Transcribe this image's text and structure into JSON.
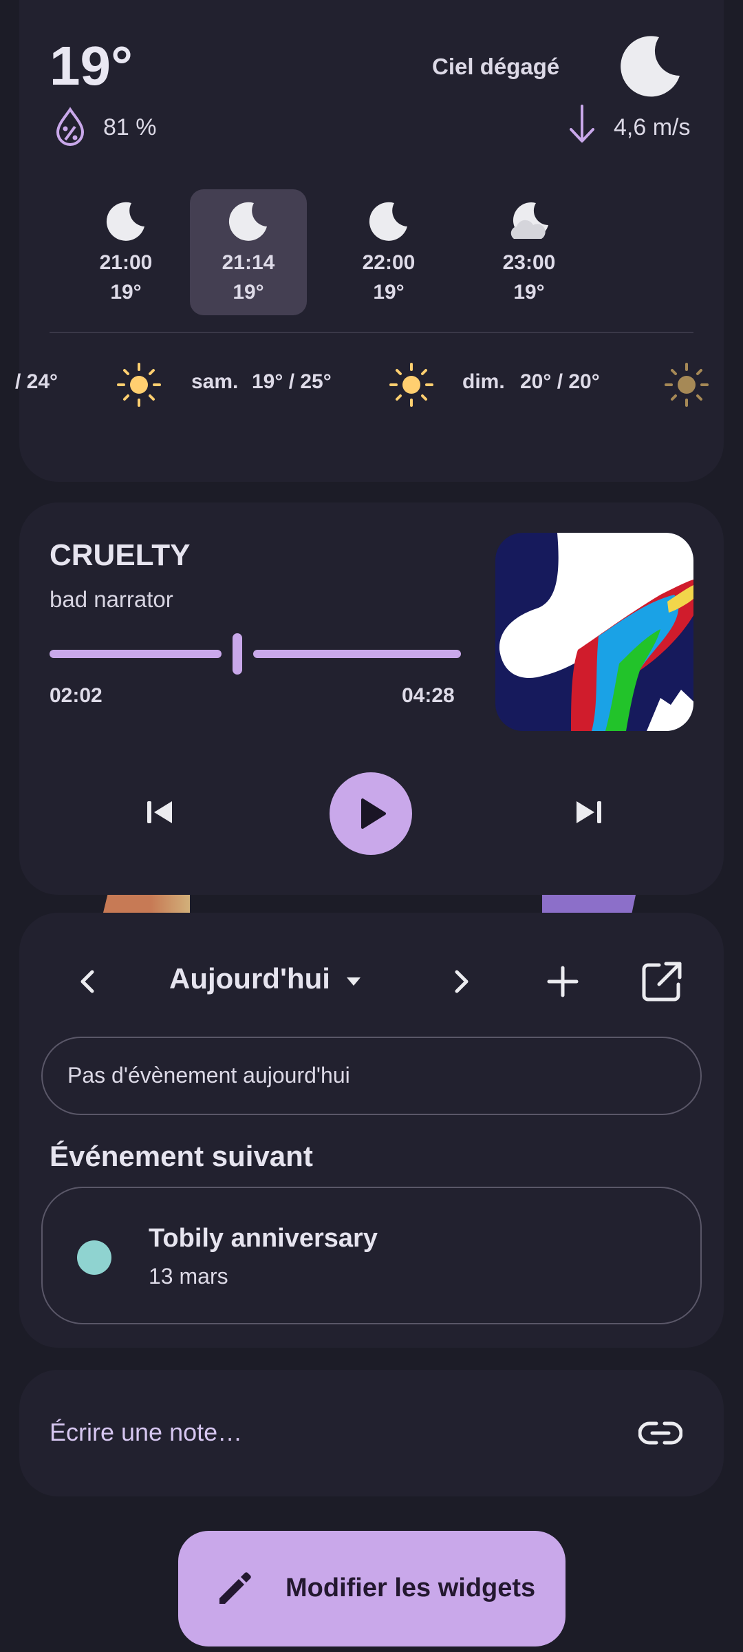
{
  "weather": {
    "temperature": "19°",
    "condition": "Ciel dégagé",
    "humidity": "81 %",
    "wind": "4,6 m/s",
    "hourly": [
      {
        "time": "21:00",
        "temp": "19°",
        "icon": "moon-icon",
        "selected": false
      },
      {
        "time": "21:14",
        "temp": "19°",
        "icon": "moon-icon",
        "selected": true
      },
      {
        "time": "22:00",
        "temp": "19°",
        "icon": "moon-icon",
        "selected": false
      },
      {
        "time": "23:00",
        "temp": "19°",
        "icon": "moon-cloud-icon",
        "selected": false
      }
    ],
    "daily": [
      {
        "label": "/ 24°"
      },
      {
        "day": "sam.",
        "range": "19° / 25°",
        "icon": "sun-icon"
      },
      {
        "day": "dim.",
        "range": "20° / 20°",
        "icon": "sun-icon"
      }
    ]
  },
  "music": {
    "title": "CRUELTY",
    "artist": "bad narrator",
    "elapsed": "02:02",
    "duration": "04:28",
    "progress": 0.456
  },
  "calendar": {
    "date_label": "Aujourd'hui",
    "no_event": "Pas d'évènement aujourd'hui",
    "next_heading": "Événement suivant",
    "next_event": {
      "title": "Tobily anniversary",
      "date": "13 mars",
      "color": "#8fd3d0"
    }
  },
  "note": {
    "placeholder": "Écrire une note…"
  },
  "fab": {
    "label": "Modifier les widgets"
  },
  "colors": {
    "background": "#1c1c27",
    "card": "#22212f",
    "accent": "#c9a8ea",
    "sun": "#ffcf70"
  }
}
